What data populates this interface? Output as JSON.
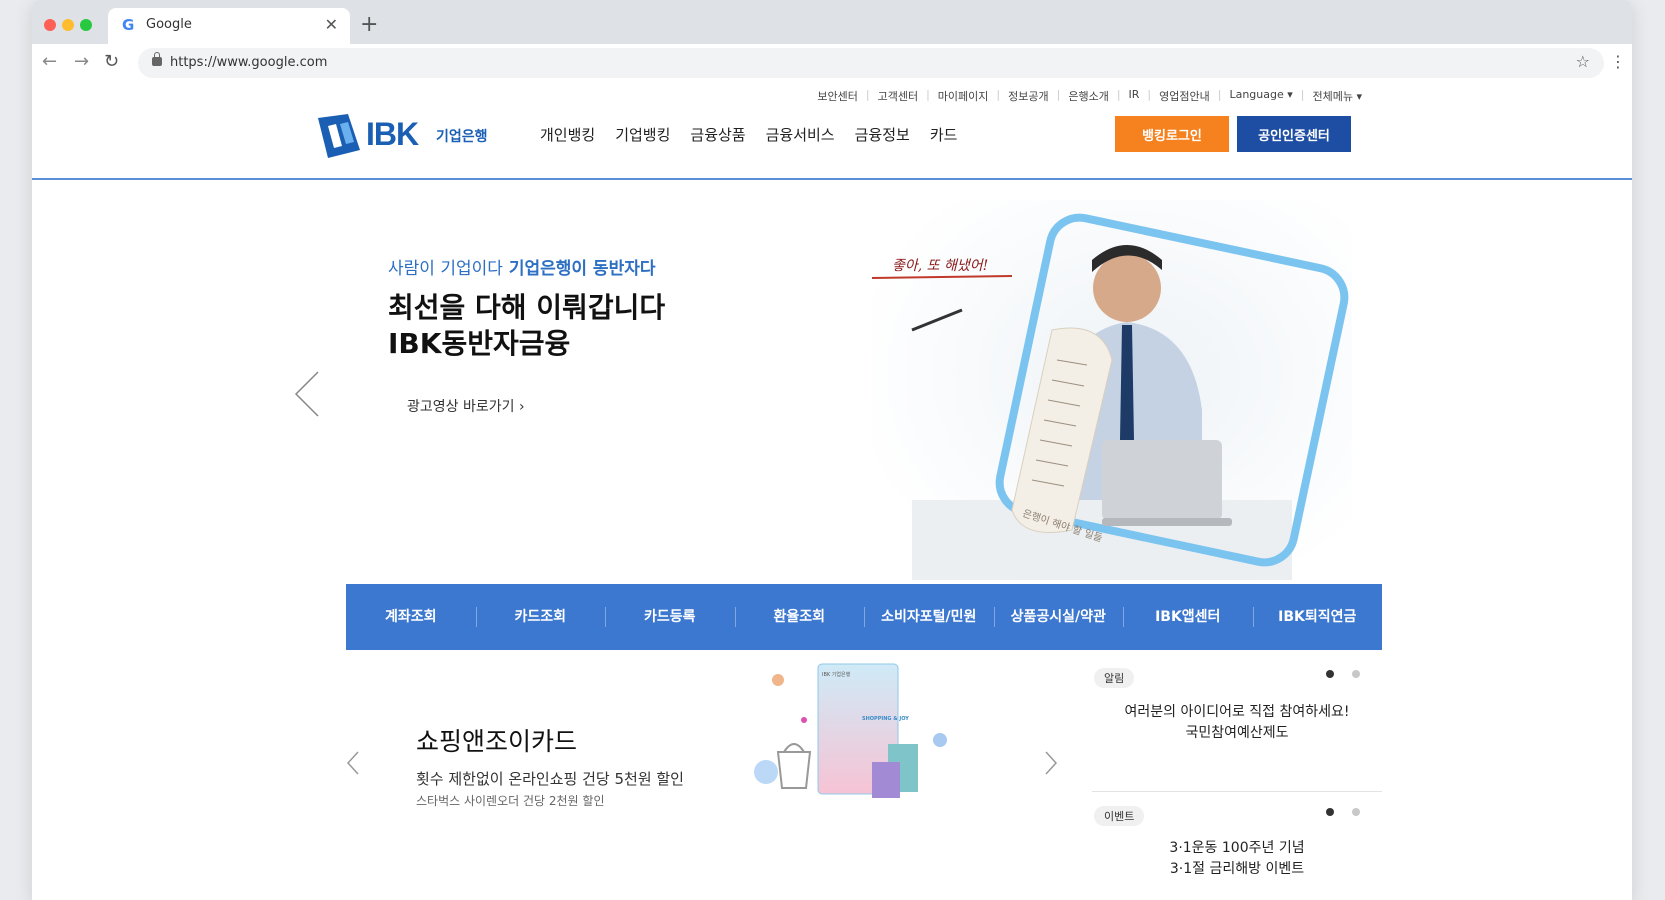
{
  "browser": {
    "tab_title": "Google",
    "tab_favicon": "G",
    "url": "https://www.google.com",
    "colors": {
      "close": "#ff5f57",
      "minimize": "#febc2e",
      "maximize": "#28c840"
    }
  },
  "util_links": [
    "보안센터",
    "고객센터",
    "마이페이지",
    "정보공개",
    "은행소개",
    "IR",
    "영업점안내",
    "Language ▾",
    "전체메뉴 ▾"
  ],
  "header": {
    "logo_text": "IBK",
    "logo_sub": "기업은행",
    "nav": [
      "개인뱅킹",
      "기업뱅킹",
      "금융상품",
      "금융서비스",
      "금융정보",
      "카드"
    ],
    "login_button": "뱅킹로그인",
    "cert_button": "공인인증센터"
  },
  "hero": {
    "subtitle_a": "사람이 기업이다",
    "subtitle_b": "기업은행이 동반자다",
    "title_line1": "최선을 다해 이뤄갑니다",
    "title_line2": "IBK동반자금융",
    "link": "광고영상 바로가기 ›",
    "handwriting": "좋아, 또 해냈어!",
    "scroll_text": "은행이 해야 할 일들"
  },
  "quick_menu": [
    "계좌조회",
    "카드조회",
    "카드등록",
    "환율조회",
    "소비자포털/민원",
    "상품공시실/약관",
    "IBK앱센터",
    "IBK퇴직연금"
  ],
  "promo": {
    "title": "쇼핑앤조이카드",
    "desc": "횟수 제한없이 온라인쇼핑 건당 5천원 할인",
    "sub": "스타벅스 사이렌오더 건당 2천원 할인",
    "card_text": "SHOPPING & JOY",
    "card_brand": "IBK 기업은행"
  },
  "notices": [
    {
      "tag": "알림",
      "line1": "여러분의 아이디어로 직접 참여하세요!",
      "line2": "국민참여예산제도"
    },
    {
      "tag": "이벤트",
      "line1": "3·1운동 100주년 기념",
      "line2": "3·1절 금리해방 이벤트"
    }
  ],
  "colors": {
    "brand_blue": "#1a5fb4",
    "quick_bar": "#3d78d0",
    "login_orange": "#f5821f",
    "cert_blue": "#1e4ea3"
  }
}
